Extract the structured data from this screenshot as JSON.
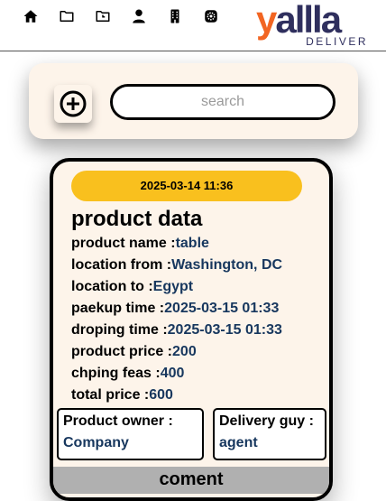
{
  "nav": {
    "icons": [
      "home-icon",
      "folder-icon",
      "folder-clock-icon",
      "user-icon",
      "building-icon",
      "settings-icon"
    ]
  },
  "logo": {
    "text": "yallla",
    "sub": "DELIVER"
  },
  "search": {
    "placeholder": "search",
    "value": ""
  },
  "colors": {
    "accent": "#f9c01e",
    "panel": "#fdf4ea",
    "value_text": "#17375e",
    "logo_orange": "#f26522",
    "logo_navy": "#2f2f5e"
  },
  "card": {
    "timestamp": "2025-03-14 11:36",
    "title": "product data",
    "fields": [
      {
        "label": "product name :",
        "value": "table"
      },
      {
        "label": "location from :",
        "value": "Washington, DC"
      },
      {
        "label": "location to :",
        "value": "Egypt"
      },
      {
        "label": "paekup time :",
        "value": "2025-03-15 01:33"
      },
      {
        "label": "droping time :",
        "value": "2025-03-15 01:33"
      },
      {
        "label": "product price :",
        "value": "200"
      },
      {
        "label": "chping feas :",
        "value": "400"
      },
      {
        "label": "total price :",
        "value": "600"
      }
    ],
    "owner": {
      "label": "Product owner :",
      "value": "Company"
    },
    "delivery": {
      "label": "Delivery guy :",
      "value": "agent"
    },
    "comment_label": "coment"
  }
}
